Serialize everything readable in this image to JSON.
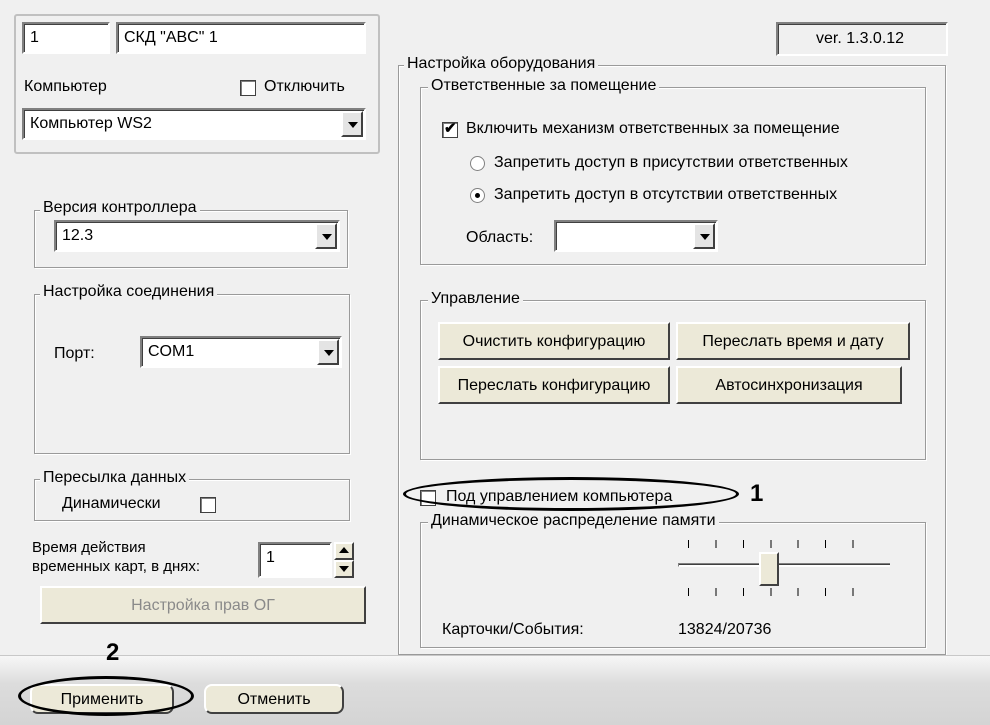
{
  "version": "ver. 1.3.0.12",
  "top_fields": {
    "number": "1",
    "name": "СКД \"ABC\" 1",
    "computer_label": "Компьютер",
    "disable_label": "Отключить",
    "computer_value": "Компьютер WS2"
  },
  "controller_version": {
    "legend": "Версия контроллера",
    "value": "12.3"
  },
  "connection": {
    "legend": "Настройка соединения",
    "port_label": "Порт:",
    "port_value": "COM1"
  },
  "data_transfer": {
    "legend": "Пересылка данных",
    "dynamic_label": "Динамически"
  },
  "temp_cards": {
    "label_line1": "Время действия",
    "label_line2": "временных карт, в днях:",
    "value": "1"
  },
  "og_rights_button": "Настройка прав ОГ",
  "equipment": {
    "legend": "Настройка оборудования",
    "responsible": {
      "legend": "Ответственные за помещение",
      "enable_label": "Включить механизм ответственных за помещение",
      "radio1_label": "Запретить доступ в присутствии ответственных",
      "radio2_label": "Запретить доступ в отсутствии ответственных",
      "area_label": "Область:",
      "area_value": ""
    },
    "control": {
      "legend": "Управление",
      "clear_config": "Очистить конфигурацию",
      "send_time": "Переслать время и дату",
      "send_config": "Переслать конфигурацию",
      "autosync": "Автосинхронизация"
    },
    "pc_control_label": "Под управлением компьютера",
    "memory": {
      "legend": "Динамическое распределение памяти",
      "cards_events_label": "Карточки/События:",
      "cards_events_value": "13824/20736",
      "slider_level_percent": 42
    }
  },
  "buttons": {
    "apply": "Применить",
    "cancel": "Отменить"
  },
  "callouts": {
    "one": "1",
    "two": "2"
  }
}
